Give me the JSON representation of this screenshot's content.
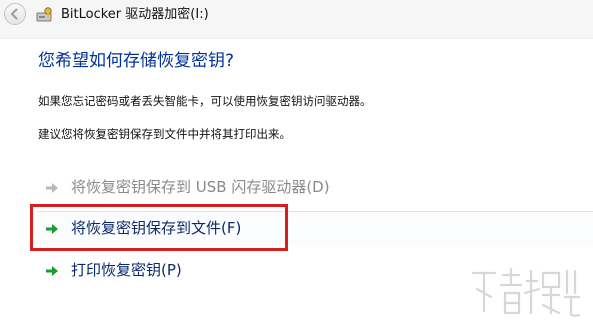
{
  "window": {
    "title": "BitLocker 驱动器加密(I:)"
  },
  "main": {
    "heading": "您希望如何存储恢复密钥?",
    "description_1": "如果您忘记密码或者丢失智能卡，可以使用恢复密钥访问驱动器。",
    "description_2": "建议您将恢复密钥保存到文件中并将其打印出来。"
  },
  "options": [
    {
      "label": "将恢复密钥保存到 USB 闪存驱动器(D)",
      "enabled": false
    },
    {
      "label": "将恢复密钥保存到文件(F)",
      "enabled": true,
      "highlighted": true
    },
    {
      "label": "打印恢复密钥(P)",
      "enabled": true
    }
  ],
  "colors": {
    "heading": "#003399",
    "arrow_enabled": "#1a9c2e",
    "arrow_disabled": "#b8b8b8",
    "highlight_box": "#d42020"
  },
  "icons": {
    "back": "back-arrow-icon",
    "title": "bitlocker-drive-key-icon",
    "option": "green-arrow-icon"
  }
}
